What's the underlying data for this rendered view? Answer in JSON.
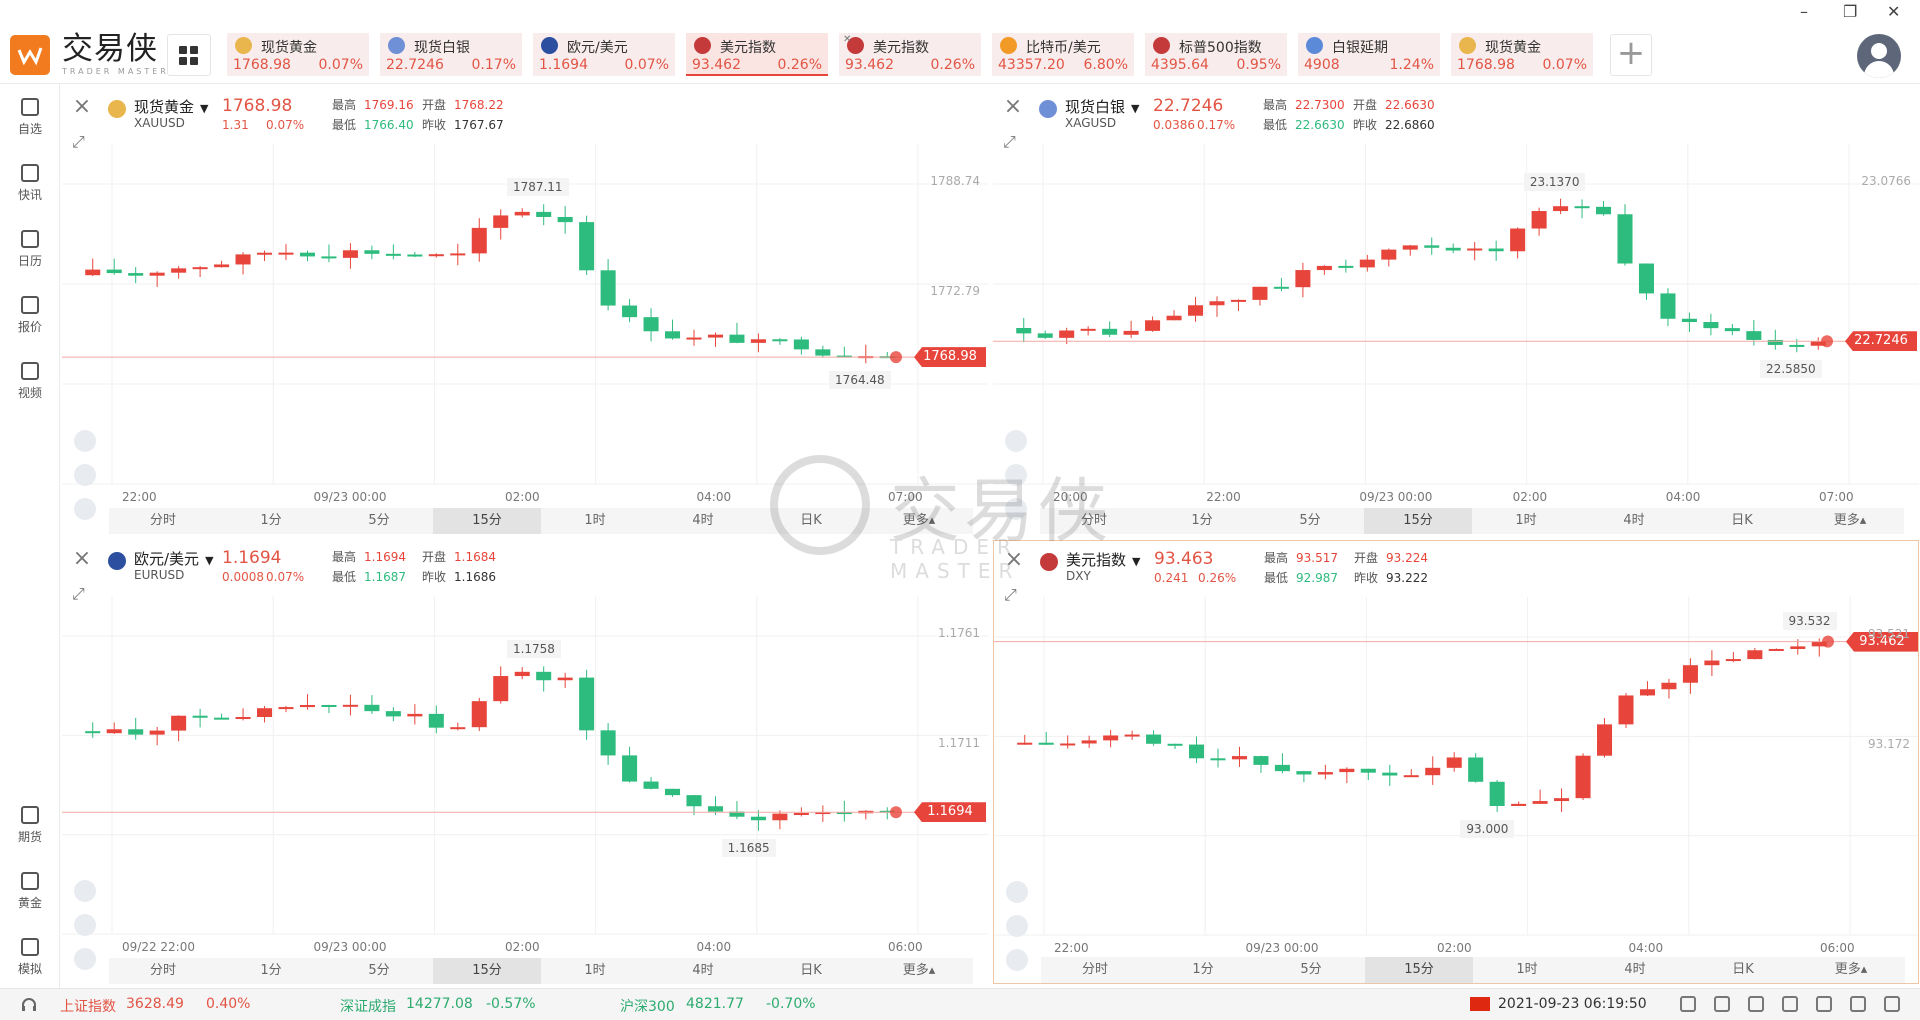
{
  "app": {
    "logo_cn": "交易侠",
    "logo_en": "TRADER MASTER"
  },
  "window": {
    "minimize": "–",
    "restore": "❐",
    "close": "✕"
  },
  "tickers": [
    {
      "name": "现货黄金",
      "price": "1768.98",
      "pct": "0.07%",
      "icon": "gold-coin-icon",
      "color": "#e9b64d",
      "active": false
    },
    {
      "name": "现货白银",
      "price": "22.7246",
      "pct": "0.17%",
      "icon": "silver-coin-icon",
      "color": "#6f8fd6",
      "active": false
    },
    {
      "name": "欧元/美元",
      "price": "1.1694",
      "pct": "0.07%",
      "icon": "eu-us-flag-icon",
      "color": "#2c4fa0",
      "active": false
    },
    {
      "name": "美元指数",
      "price": "93.462",
      "pct": "0.26%",
      "icon": "us-flag-icon",
      "color": "#c43a3a",
      "active": true
    },
    {
      "name": "美元指数",
      "price": "93.462",
      "pct": "0.26%",
      "icon": "us-flag-icon",
      "color": "#c43a3a",
      "active": false
    },
    {
      "name": "比特币/美元",
      "price": "43357.20",
      "pct": "6.80%",
      "icon": "bitcoin-icon",
      "color": "#f29a26",
      "active": false
    },
    {
      "name": "标普500指数",
      "price": "4395.64",
      "pct": "0.95%",
      "icon": "us-flag-icon",
      "color": "#c43a3a",
      "active": false
    },
    {
      "name": "白银延期",
      "price": "4908",
      "pct": "1.24%",
      "icon": "silver-ingot-icon",
      "color": "#5b8ad8",
      "active": false
    },
    {
      "name": "现货黄金",
      "price": "1768.98",
      "pct": "0.07%",
      "icon": "gold-coin-icon",
      "color": "#e9b64d",
      "active": false
    }
  ],
  "sidebar_top": [
    {
      "label": "自选",
      "icon": "watchlist-add-icon"
    },
    {
      "label": "快讯",
      "icon": "news-list-icon"
    },
    {
      "label": "日历",
      "icon": "calendar-icon"
    },
    {
      "label": "报价",
      "icon": "quote-chart-icon"
    },
    {
      "label": "视频",
      "icon": "video-play-icon"
    }
  ],
  "sidebar_bottom": [
    {
      "label": "期货",
      "icon": "futures-icon"
    },
    {
      "label": "黄金",
      "icon": "gold-bars-icon"
    },
    {
      "label": "模拟",
      "icon": "simulation-icon"
    }
  ],
  "stat_labels": {
    "high": "最高",
    "open": "开盘",
    "low": "最低",
    "prev": "昨收"
  },
  "tabs": [
    "分时",
    "1分",
    "5分",
    "15分",
    "1时",
    "4时",
    "日K",
    "更多▴"
  ],
  "active_tab": "15分",
  "panels": [
    {
      "symbol": "现货黄金",
      "code": "XAUUSD",
      "flag_color": "#e9b64d",
      "last": "1768.98",
      "chg": "1.31",
      "pct": "0.07%",
      "high": "1769.16",
      "open": "1768.22",
      "low": "1766.40",
      "prev": "1767.67",
      "price_tag": "1768.98",
      "max_label": "1787.11",
      "min_label": "1764.48",
      "y_ticks": [
        "1788.74",
        "1772.79"
      ],
      "x_ticks": [
        "22:00",
        "09/23 00:00",
        "02:00",
        "04:00",
        "07:00"
      ]
    },
    {
      "symbol": "现货白银",
      "code": "XAGUSD",
      "flag_color": "#6f8fd6",
      "last": "22.7246",
      "chg": "0.0386",
      "pct": "0.17%",
      "high": "22.7300",
      "open": "22.6630",
      "low": "22.6630",
      "prev": "22.6860",
      "price_tag": "22.7246",
      "max_label": "23.1370",
      "min_label": "22.5850",
      "y_ticks": [
        "23.0766"
      ],
      "x_ticks": [
        "20:00",
        "22:00",
        "09/23 00:00",
        "02:00",
        "04:00",
        "07:00"
      ]
    },
    {
      "symbol": "欧元/美元",
      "code": "EURUSD",
      "flag_color": "#2c4fa0",
      "last": "1.1694",
      "chg": "0.0008",
      "pct": "0.07%",
      "high": "1.1694",
      "open": "1.1684",
      "low": "1.1687",
      "prev": "1.1686",
      "price_tag": "1.1694",
      "max_label": "1.1758",
      "min_label": "1.1685",
      "y_ticks": [
        "1.1761",
        "1.1711"
      ],
      "x_ticks": [
        "09/22 22:00",
        "09/23 00:00",
        "02:00",
        "04:00",
        "06:00"
      ]
    },
    {
      "symbol": "美元指数",
      "code": "DXY",
      "flag_color": "#c43a3a",
      "last": "93.463",
      "chg": "0.241",
      "pct": "0.26%",
      "high": "93.517",
      "open": "93.224",
      "low": "92.987",
      "prev": "93.222",
      "price_tag": "93.462",
      "max_label": "93.532",
      "min_label": "93.000",
      "y_ticks": [
        "93.521",
        "93.172"
      ],
      "x_ticks": [
        "22:00",
        "09/23 00:00",
        "02:00",
        "04:00",
        "06:00"
      ]
    }
  ],
  "watermark": {
    "cn": "交易侠",
    "en": "TRADER MASTER"
  },
  "status": {
    "items": [
      {
        "name": "上证指数",
        "value": "3628.49",
        "pct": "0.40%",
        "color": "#e25545"
      },
      {
        "name": "深证成指",
        "value": "14277.08",
        "pct": "-0.57%",
        "color": "#2dab6f"
      },
      {
        "name": "沪深300",
        "value": "4821.77",
        "pct": "-0.70%",
        "color": "#2dab6f"
      }
    ],
    "datetime": "2021-09-23 06:19:50"
  }
}
